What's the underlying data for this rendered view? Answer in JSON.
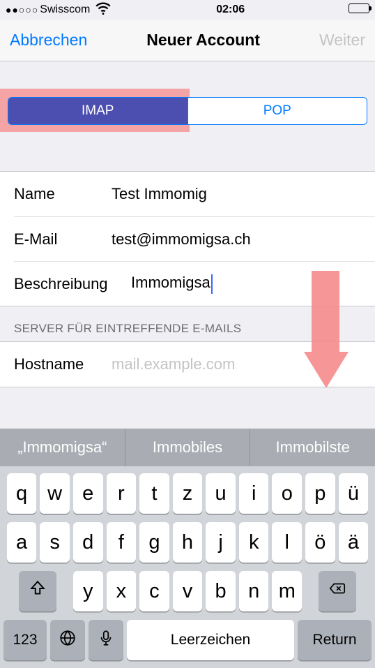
{
  "status": {
    "carrier": "Swisscom",
    "time": "02:06",
    "signal_dots": "●●○○○"
  },
  "nav": {
    "cancel": "Abbrechen",
    "title": "Neuer Account",
    "next": "Weiter"
  },
  "segmented": {
    "imap": "IMAP",
    "pop": "POP"
  },
  "fields": {
    "name_label": "Name",
    "name_value": "Test Immomig",
    "email_label": "E-Mail",
    "email_value": "test@immomigsa.ch",
    "desc_label": "Beschreibung",
    "desc_value": "Immomigsa"
  },
  "incoming": {
    "header": "SERVER FÜR EINTREFFENDE E-MAILS",
    "hostname_label": "Hostname",
    "hostname_placeholder": "mail.example.com"
  },
  "predict": {
    "a": "„Immomigsa“",
    "b": "Immobiles",
    "c": "Immobilste"
  },
  "keys": {
    "row1": [
      "q",
      "w",
      "e",
      "r",
      "t",
      "z",
      "u",
      "i",
      "o",
      "p",
      "ü"
    ],
    "row2": [
      "a",
      "s",
      "d",
      "f",
      "g",
      "h",
      "j",
      "k",
      "l",
      "ö",
      "ä"
    ],
    "row3": [
      "y",
      "x",
      "c",
      "v",
      "b",
      "n",
      "m"
    ],
    "num": "123",
    "space": "Leerzeichen",
    "return": "Return"
  }
}
